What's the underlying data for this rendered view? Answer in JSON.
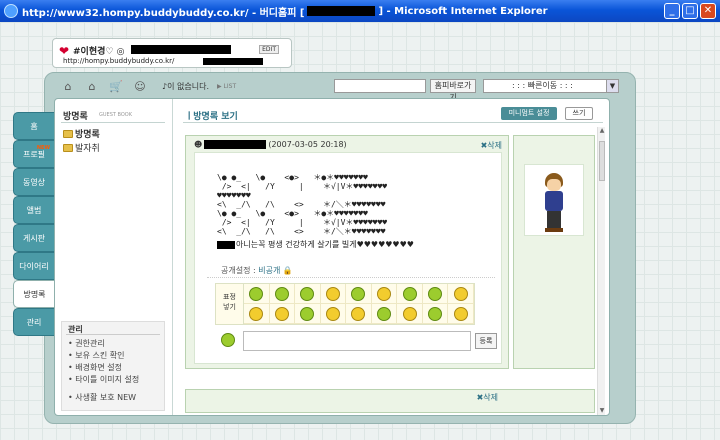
{
  "window": {
    "title_prefix": "http://www32.hompy.buddybuddy.co.kr/ - 버디홈피 [",
    "title_suffix": "] - Microsoft Internet Explorer"
  },
  "namecard": {
    "name": "#이현경♡ ◎",
    "edit": "EDIT",
    "url": "http://hompy.buddybuddy.co.kr/"
  },
  "toolbar": {
    "music": "♪이 없습니다.",
    "list": "▶ LIST",
    "go": "홈피바로가기",
    "quick": ": : : 빠른이동 : : :"
  },
  "tabs": [
    {
      "label": "홈"
    },
    {
      "label": "프로필",
      "badge": "NEW"
    },
    {
      "label": "동영상"
    },
    {
      "label": "앨범"
    },
    {
      "label": "게시판"
    },
    {
      "label": "다이어리"
    },
    {
      "label": "방명록"
    },
    {
      "label": "관리"
    }
  ],
  "left": {
    "title": "방명록",
    "subtitle": "GUEST BOOK",
    "folders": [
      "방명록",
      "발자취"
    ],
    "manage_title": "관리",
    "manage": [
      "• 권한관리",
      "• 보유 스킨 확인",
      "• 배경화면 설정",
      "• 타이틀 이미지 설정"
    ],
    "privacy": "• 사생활 보호 NEW"
  },
  "main": {
    "title": "ㅣ방명록 보기",
    "minimi_btn": "미니멈트 설정",
    "write_btn": "쓰기",
    "post": {
      "date": "(2007-03-05 20:18)",
      "delete": "✖삭제",
      "art": "\\● ●_   \\●    <●>   ＊●＊♥♥♥♥♥♥♥\n />  <|   /Y     |    ＊√|V＊♥♥♥♥♥♥♥\n♥♥♥♥♥♥♥\n<\\  _/\\   /\\    <>    ＊/＼＊♥♥♥♥♥♥♥\n\\● ●_   \\●    <●>   ＊●＊♥♥♥♥♥♥♥\n />  <|   /Y     |    ＊√|V＊♥♥♥♥♥♥♥\n<\\  _/\\   /\\    <>    ＊/＼＊♥♥♥♥♥♥♥",
      "message": "아니는꼭 평생 건강하게 살기를 빌게♥♥♥♥♥♥♥♥",
      "privacy_label": "공개설정 : ",
      "privacy_value": "비공개",
      "emo_label": "표정\n넣기",
      "submit": "등록"
    },
    "post2": {
      "delete": "✖삭제"
    }
  }
}
